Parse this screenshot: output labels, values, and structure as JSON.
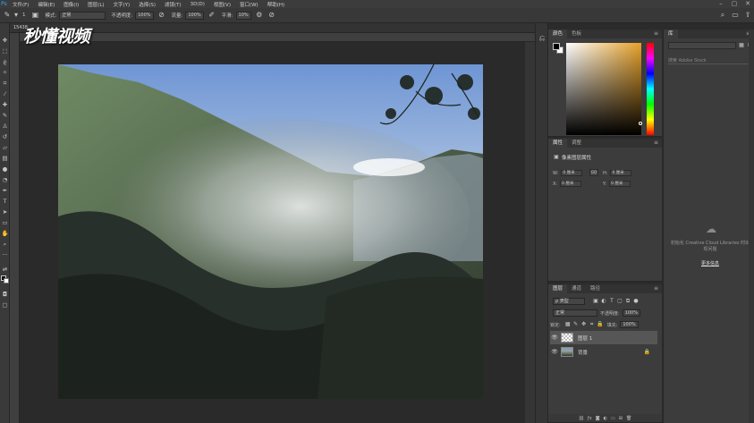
{
  "menubar": {
    "items": [
      "文件(F)",
      "编辑(E)",
      "图像(I)",
      "图层(L)",
      "文字(Y)",
      "选择(S)",
      "滤镜(T)",
      "3D(D)",
      "视图(V)",
      "窗口(W)",
      "帮助(H)"
    ],
    "window_controls": [
      "–",
      "▢",
      "✕"
    ]
  },
  "options": {
    "brush_size": "1",
    "mode_label": "模式:",
    "mode_value": "正常",
    "opacity_label": "不透明度:",
    "opacity_value": "100%",
    "flow_label": "流量:",
    "flow_value": "100%",
    "smooth_label": "平滑:",
    "smooth_value": "10%"
  },
  "document": {
    "tab_title": "15438...",
    "watermark": "秒懂视频"
  },
  "color_panel": {
    "tabs": [
      "颜色",
      "色板"
    ],
    "foreground": "#000000",
    "background": "#ffffff",
    "hue_color": "#e6a12a"
  },
  "properties_panel": {
    "tabs": [
      "属性",
      "调整"
    ],
    "title": "像素图层属性",
    "w_label": "W:",
    "w_value": "0 厘米",
    "h_label": "H:",
    "h_value": "0 厘米",
    "x_label": "X:",
    "x_value": "0 厘米",
    "y_label": "Y:",
    "y_value": "0 厘米",
    "link_label": "GO"
  },
  "layers_panel": {
    "tabs": [
      "图层",
      "通道",
      "路径"
    ],
    "kind_filter": "ρ 类型",
    "blend_mode": "正常",
    "opacity_label": "不透明度:",
    "opacity_value": "100%",
    "lock_label": "锁定:",
    "fill_label": "填充:",
    "fill_value": "100%",
    "layers": [
      {
        "name": "图层 1",
        "visible": true,
        "active": true
      },
      {
        "name": "背景",
        "visible": true,
        "active": false,
        "locked": true
      }
    ]
  },
  "libraries_panel": {
    "tab": "库",
    "search_placeholder": "搜索 Adobe Stock",
    "message": "初始化 Creative Cloud Libraries 时出现问题",
    "link": "更多信息"
  }
}
